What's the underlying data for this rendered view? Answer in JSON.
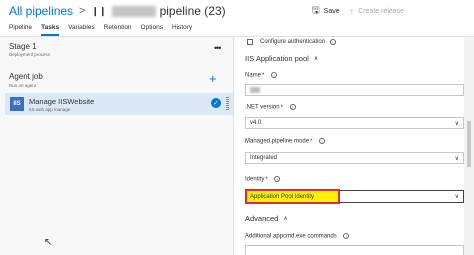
{
  "header": {
    "breadcrumb_root": "All pipelines",
    "breadcrumb_sep": ">",
    "pipeline_suffix": "pipeline (23)",
    "save_label": "Save",
    "create_release_label": "Create release"
  },
  "tabs": [
    "Pipeline",
    "Tasks",
    "Variables",
    "Retention",
    "Options",
    "History"
  ],
  "active_tab": "Tasks",
  "left": {
    "stage_name": "Stage 1",
    "stage_sub": "Deployment process",
    "stage_more": "•••",
    "agent_job": "Agent job",
    "agent_sub": "Run on agent",
    "add_icon": "+",
    "task_icon_text": "IIS",
    "task_name": "Manage IISWebsite",
    "task_sub": "IIS web app manage"
  },
  "right": {
    "configure_auth_label": "Configure authentication",
    "section_iis": "IIS Application pool",
    "name_label": "Name",
    "net_version_label": ".NET version",
    "net_version_value": "v4.0",
    "pipeline_mode_label": "Managed pipeline mode",
    "pipeline_mode_value": "Integrated",
    "identity_label": "Identity",
    "identity_value": "Application Pool Identity",
    "section_advanced": "Advanced",
    "appcmd_label": "Additional appcmd.exe commands"
  },
  "icons": {
    "info": "i",
    "chevron_up": "∧",
    "dropdown": "∨"
  },
  "colors": {
    "accent": "#0078d4",
    "highlight_fill": "#fff200",
    "highlight_border": "#e32b2b",
    "selected_task_bg": "#dbe9f7"
  }
}
